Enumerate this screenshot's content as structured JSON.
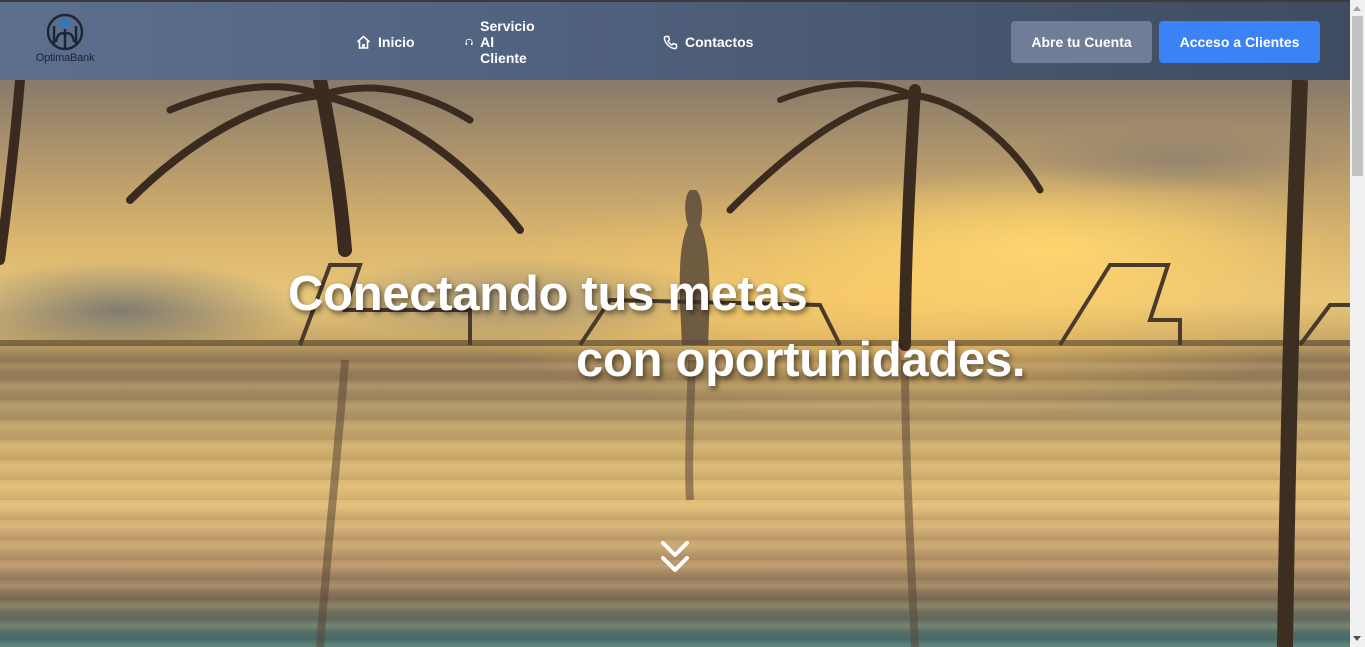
{
  "brand": {
    "name": "OptimaBank"
  },
  "nav": {
    "items": [
      {
        "label": "Inicio",
        "icon": "home-icon"
      },
      {
        "label": "Servicio Al Cliente",
        "icon": "headset-icon"
      },
      {
        "label": "Contactos",
        "icon": "phone-icon"
      }
    ]
  },
  "actions": {
    "open_account": "Abre tu Cuenta",
    "client_access": "Acceso a Clientes"
  },
  "hero": {
    "line1": "Conectando tus metas",
    "line2": "con oportunidades.",
    "scroll_icon": "double-chevron-down-icon"
  },
  "colors": {
    "header_start": "#5d6f8f",
    "header_end": "#3f4b60",
    "open_account_bg": "#6f7d97",
    "client_access_bg": "#3b82f6",
    "logo_accent": "#2f79b8"
  }
}
